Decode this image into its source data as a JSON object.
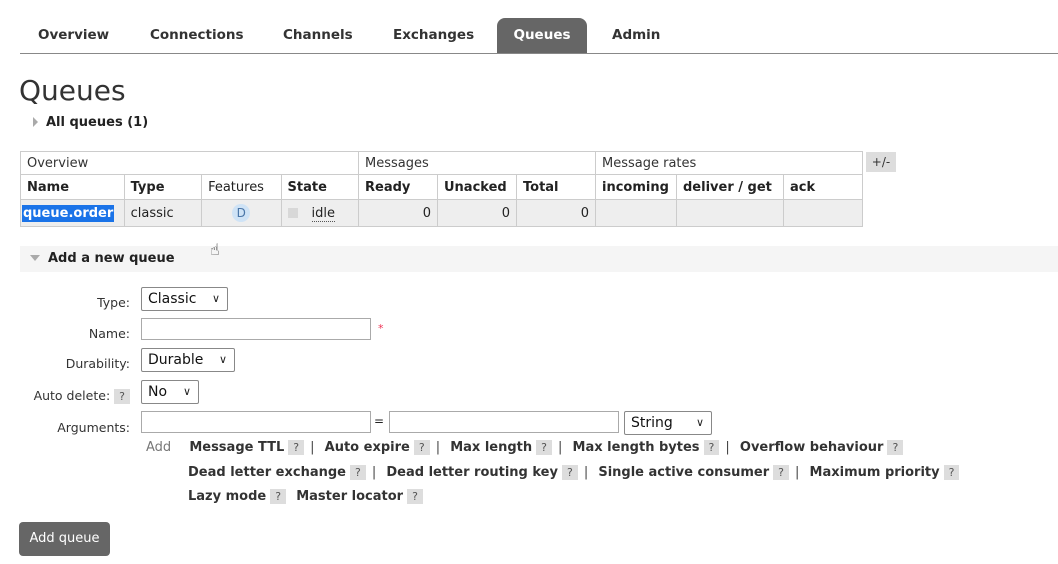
{
  "tabs": [
    {
      "label": "Overview"
    },
    {
      "label": "Connections"
    },
    {
      "label": "Channels"
    },
    {
      "label": "Exchanges"
    },
    {
      "label": "Queues",
      "active": true
    },
    {
      "label": "Admin"
    }
  ],
  "page_title": "Queues",
  "all_queues_label": "All queues (1)",
  "table": {
    "group_headers": {
      "overview": "Overview",
      "messages": "Messages",
      "rates": "Message rates"
    },
    "plus_minus": "+/-",
    "columns": [
      "Name",
      "Type",
      "Features",
      "State",
      "Ready",
      "Unacked",
      "Total",
      "incoming",
      "deliver / get",
      "ack"
    ],
    "row": {
      "name": "queue.order",
      "type": "classic",
      "feature": "D",
      "state": "idle",
      "ready": "0",
      "unacked": "0",
      "total": "0"
    }
  },
  "add_queue": {
    "section_label": "Add a new queue",
    "type_label": "Type:",
    "type_value": "Classic",
    "name_label": "Name:",
    "name_value": "",
    "required_mark": "*",
    "durability_label": "Durability:",
    "durability_value": "Durable",
    "auto_delete_label": "Auto delete:",
    "auto_delete_value": "No",
    "arguments_label": "Arguments:",
    "equals": "=",
    "arg_type_value": "String",
    "help": "?",
    "add_link": "Add",
    "args_line1": [
      "Message TTL",
      "Auto expire",
      "Max length",
      "Max length bytes",
      "Overflow behaviour"
    ],
    "args_line2": [
      "Dead letter exchange",
      "Dead letter routing key",
      "Single active consumer",
      "Maximum priority"
    ],
    "args_line3": [
      "Lazy mode",
      "Master locator"
    ],
    "submit_label": "Add queue"
  }
}
